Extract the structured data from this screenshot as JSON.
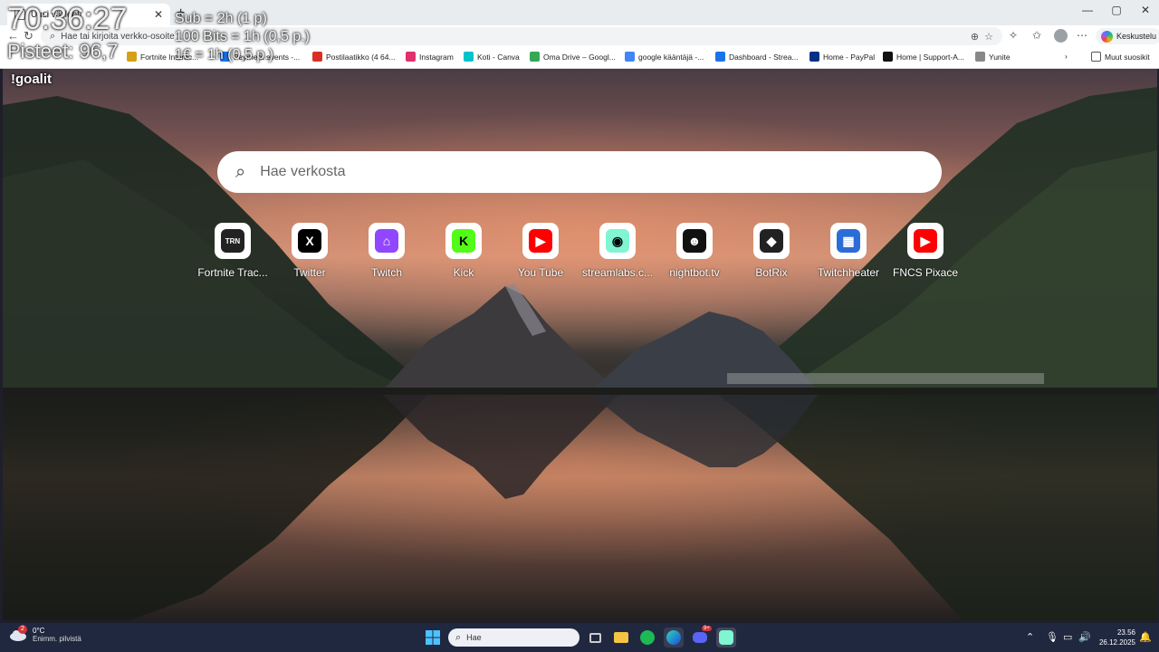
{
  "browser": {
    "tab_title": "Uusi välilehti",
    "address_placeholder": "Hae tai kirjoita verkko-osoite",
    "copilot_label": "Keskustelu",
    "other_favorites": "Muut suosikit",
    "bookmarks": [
      {
        "label": "Fortnite Interac...",
        "color": "#d4a017"
      },
      {
        "label": "Payment events -...",
        "color": "#1a73e8"
      },
      {
        "label": "Postilaatikko (4 64...",
        "color": "#d93025"
      },
      {
        "label": "Instagram",
        "color": "#e1306c"
      },
      {
        "label": "Koti - Canva",
        "color": "#00c4cc"
      },
      {
        "label": "Oma Drive – Googl...",
        "color": "#34a853"
      },
      {
        "label": "google kääntäjä -...",
        "color": "#4285f4"
      },
      {
        "label": "Dashboard - Strea...",
        "color": "#1a73e8"
      },
      {
        "label": "Home - PayPal",
        "color": "#003087"
      },
      {
        "label": "Home | Support-A...",
        "color": "#111111"
      },
      {
        "label": "Yunite",
        "color": "#888888"
      }
    ]
  },
  "overlay": {
    "goalit": "!goalit",
    "timer": "70:36:27",
    "pisteet": "Pisteet: 96,7",
    "rules": [
      "Sub = 2h (1 p)",
      "100 Bits = 1h (0,5 p.)",
      "1€ = 1h (0,5 p.)"
    ]
  },
  "ntp": {
    "search_placeholder": "Hae verkosta",
    "shortcuts": [
      {
        "label": "Fortnite Trac...",
        "glyph": "TRN",
        "color": "#222222"
      },
      {
        "label": "Twitter",
        "glyph": "X",
        "color": "#000000"
      },
      {
        "label": "Twitch",
        "glyph": "⌂",
        "color": "#9146ff"
      },
      {
        "label": "Kick",
        "glyph": "K",
        "color": "#53fc18"
      },
      {
        "label": "You Tube",
        "glyph": "▶",
        "color": "#ff0000"
      },
      {
        "label": "streamlabs.c...",
        "glyph": "◉",
        "color": "#80f5d2"
      },
      {
        "label": "nightbot.tv",
        "glyph": "☻",
        "color": "#111111"
      },
      {
        "label": "BotRix",
        "glyph": "◆",
        "color": "#222222"
      },
      {
        "label": "Twitchheater",
        "glyph": "▦",
        "color": "#2b6cd8"
      },
      {
        "label": "FNCS Pixace",
        "glyph": "▶",
        "color": "#ff0000"
      }
    ]
  },
  "taskbar": {
    "weather_badge": "2",
    "weather_temp": "0°C",
    "weather_desc": "Enimm. pilvistä",
    "search_text": "Hae",
    "discord_badge": "9+",
    "time": "23.56",
    "date": "26.12.2025"
  }
}
